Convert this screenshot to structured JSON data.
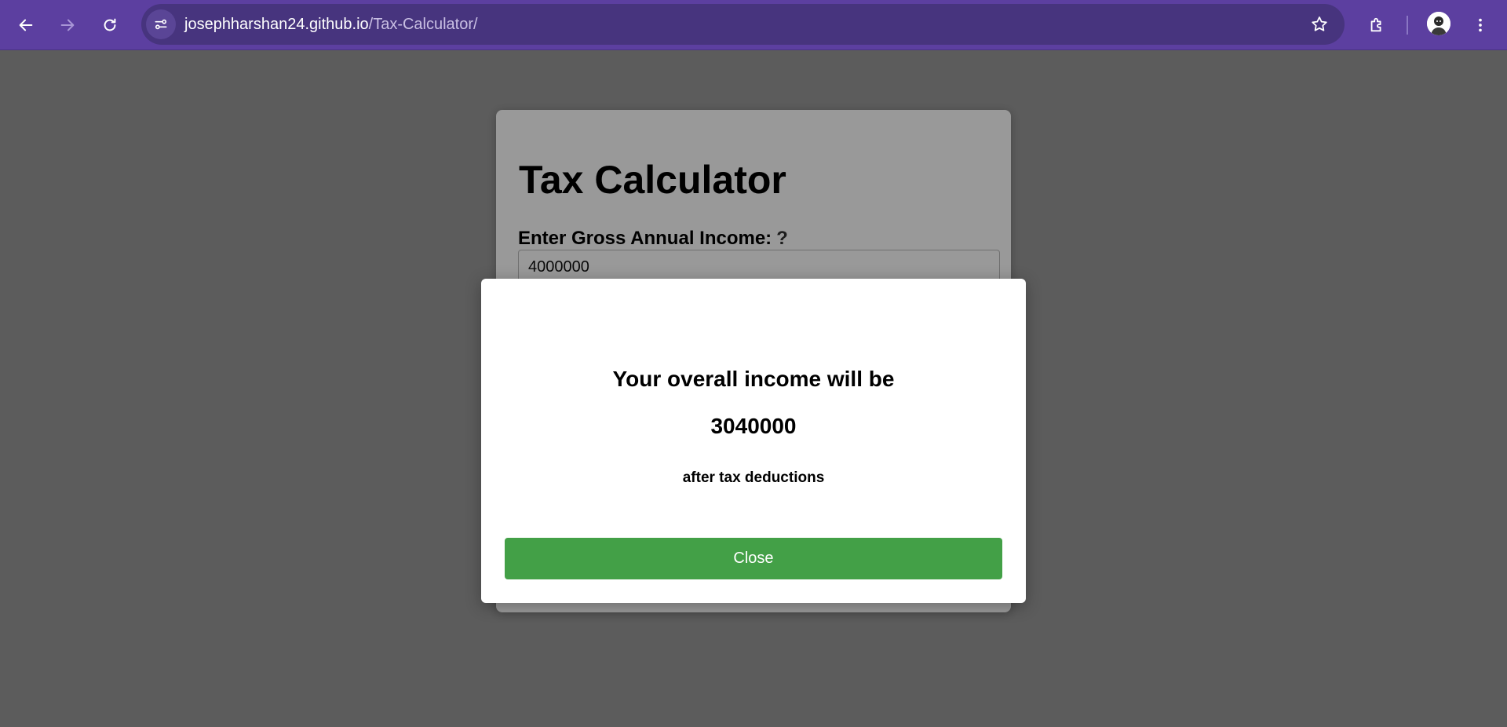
{
  "browser": {
    "url_host": "josephharshan24.github.io",
    "url_path": "/Tax-Calculator/",
    "icons": [
      "back-icon",
      "forward-icon",
      "reload-icon",
      "site-info-icon",
      "bookmark-star-icon",
      "extensions-icon",
      "profile-avatar",
      "more-menu-icon"
    ]
  },
  "page": {
    "title": "Tax Calculator",
    "income_label": "Enter Gross Annual Income:",
    "help_mark": "?",
    "income_value": "4000000"
  },
  "modal": {
    "line1": "Your overall income will be",
    "amount": "3040000",
    "line3": "after tax deductions",
    "close_label": "Close"
  },
  "colors": {
    "chrome": "#5c3fa0",
    "omnibox": "#47347e",
    "close_button": "#43a047",
    "overlay": "rgba(0,0,0,0.4)"
  }
}
